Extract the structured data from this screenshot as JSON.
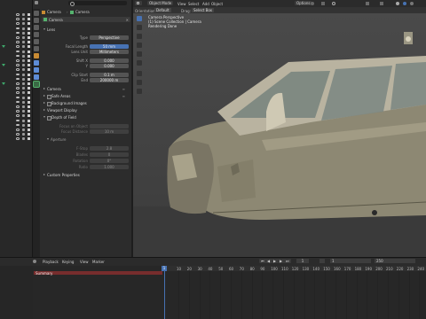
{
  "outliner": {
    "row_count": 28
  },
  "properties": {
    "search_placeholder": "",
    "breadcrumb": [
      "Camera",
      "Camera"
    ],
    "datablock_name": "Camera",
    "lens_section": "Lens",
    "fields": [
      {
        "label": "Type",
        "value": "Perspective"
      },
      {
        "label": "Focal Length",
        "value": "50 mm"
      },
      {
        "label": "Lens Unit",
        "value": "Millimeters"
      },
      {
        "label": "Shift X",
        "value": "0.000"
      },
      {
        "label": "Y",
        "value": "0.000"
      },
      {
        "label": "Clip Start",
        "value": "0.1 m"
      },
      {
        "label": "End",
        "value": "200000 m"
      }
    ],
    "sections": [
      "Camera",
      "Safe Areas",
      "Background Images",
      "Viewport Display",
      "Depth of Field"
    ],
    "dof_fields": [
      {
        "label": "Focus on Object",
        "value": ""
      },
      {
        "label": "Focus Distance",
        "value": "10 m"
      }
    ],
    "aperture_label": "Aperture",
    "aperture_fields": [
      {
        "label": "F-Stop",
        "value": "2.8"
      },
      {
        "label": "Blades",
        "value": "0"
      },
      {
        "label": "Rotation",
        "value": "0°"
      },
      {
        "label": "Ratio",
        "value": "1.000"
      }
    ],
    "custom_properties": "Custom Properties"
  },
  "viewport": {
    "header": {
      "mode": "Object Mode",
      "menus": [
        "View",
        "Select",
        "Add",
        "Object"
      ],
      "orientation_label": "Orientation:",
      "orientation": "Default",
      "drag_label": "Drag:",
      "drag": "Select Box",
      "options": "Options"
    },
    "overlay_lines": [
      "Camera Perspective",
      "(1) Scene Collection | Camera",
      "Rendering Done"
    ]
  },
  "timeline": {
    "menus": [
      "Playback",
      "Keying",
      "View",
      "Marker"
    ],
    "summary": "Summary",
    "current_frame": "1",
    "frames": [
      "10",
      "20",
      "30",
      "40",
      "50",
      "60",
      "70",
      "80",
      "90",
      "100",
      "110",
      "120",
      "130",
      "140",
      "150",
      "160",
      "170",
      "180",
      "190",
      "200",
      "210",
      "220",
      "230",
      "240",
      "250"
    ],
    "start": "1",
    "end": "250"
  },
  "colors": {
    "accent": "#4772b3",
    "summary": "#772d2d",
    "outliner_tri": "#3ea86b"
  }
}
